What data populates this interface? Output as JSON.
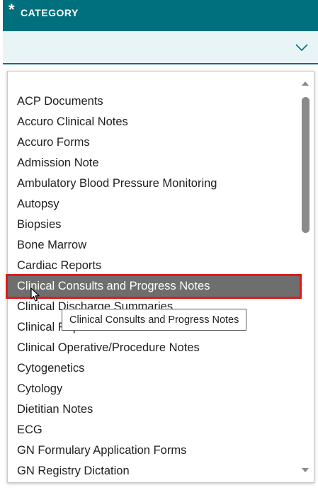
{
  "header": {
    "required_marker": "*",
    "title": "CATEGORY"
  },
  "select": {
    "value": "",
    "icon": "chevron-down-icon"
  },
  "dropdown": {
    "items": [
      {
        "label": "ACP Documents"
      },
      {
        "label": "Accuro Clinical Notes"
      },
      {
        "label": "Accuro Forms"
      },
      {
        "label": "Admission Note"
      },
      {
        "label": "Ambulatory Blood Pressure Monitoring"
      },
      {
        "label": "Autopsy"
      },
      {
        "label": "Biopsies"
      },
      {
        "label": "Bone Marrow"
      },
      {
        "label": "Cardiac Reports"
      },
      {
        "label": "Clinical Consults and Progress Notes",
        "highlighted": true
      },
      {
        "label": "Clinical Discharge Summaries"
      },
      {
        "label": "Clinical Reports"
      },
      {
        "label": "Clinical Operative/Procedure Notes"
      },
      {
        "label": "Cytogenetics"
      },
      {
        "label": "Cytology"
      },
      {
        "label": "Dietitian Notes"
      },
      {
        "label": "ECG"
      },
      {
        "label": "GN Formulary Application Forms"
      },
      {
        "label": "GN Registry Dictation"
      }
    ],
    "tooltip": "Clinical Consults and Progress Notes"
  },
  "colors": {
    "header_bg": "#00707f",
    "select_bg": "#e9f4f7",
    "highlight_bg": "#6e6e6e",
    "highlight_outline": "#e0191c"
  }
}
